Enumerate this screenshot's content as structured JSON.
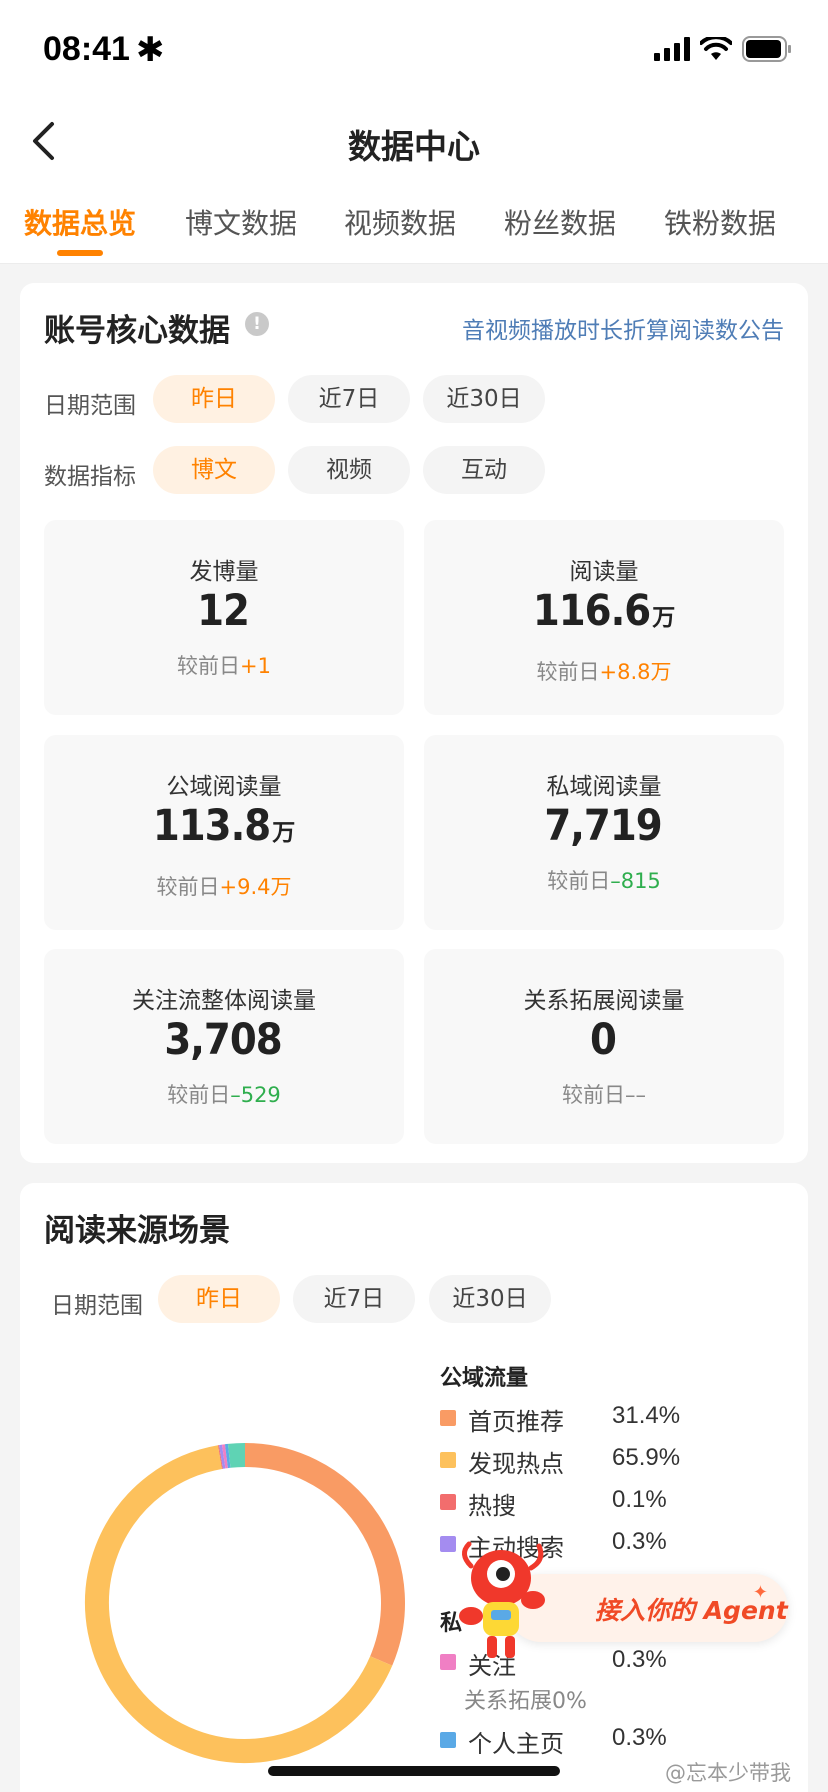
{
  "status": {
    "time": "08:41",
    "star": "✱"
  },
  "nav": {
    "title": "数据中心"
  },
  "tabs": [
    {
      "label": "数据总览",
      "active": true
    },
    {
      "label": "博文数据"
    },
    {
      "label": "视频数据"
    },
    {
      "label": "粉丝数据"
    },
    {
      "label": "铁粉数据"
    }
  ],
  "core": {
    "title": "账号核心数据",
    "info_glyph": "!",
    "notice": "音视频播放时长折算阅读数公告",
    "date_label": "日期范围",
    "date_options": [
      "昨日",
      "近7日",
      "近30日"
    ],
    "metric_label": "数据指标",
    "metric_options": [
      "博文",
      "视频",
      "互动"
    ],
    "compare_label": "较前日",
    "stats": [
      {
        "label": "发博量",
        "value": "12",
        "unit": "",
        "delta": "+1"
      },
      {
        "label": "阅读量",
        "value": "116.6",
        "unit": "万",
        "delta": "+8.8万"
      },
      {
        "label": "公域阅读量",
        "value": "113.8",
        "unit": "万",
        "delta": "+9.4万"
      },
      {
        "label": "私域阅读量",
        "value": "7,719",
        "unit": "",
        "delta": "–815"
      },
      {
        "label": "关注流整体阅读量",
        "value": "3,708",
        "unit": "",
        "delta": "–529"
      },
      {
        "label": "关系拓展阅读量",
        "value": "0",
        "unit": "",
        "delta": "––"
      }
    ]
  },
  "source": {
    "title": "阅读来源场景",
    "date_label": "日期范围",
    "date_options": [
      "昨日",
      "近7日",
      "近30日"
    ],
    "public_title": "公域流量",
    "private_title_fragment": "私",
    "legend": [
      {
        "name": "首页推荐",
        "pct": "31.4%",
        "color": "#f99b64"
      },
      {
        "name": "发现热点",
        "pct": "65.9%",
        "color": "#fdc15c"
      },
      {
        "name": "热搜",
        "pct": "0.1%",
        "color": "#f26d6d"
      },
      {
        "name": "主动搜索",
        "pct": "0.3%",
        "color": "#a48cf0"
      },
      {
        "name": "关注",
        "pct": "0.3%",
        "color": "#f07fc4"
      },
      {
        "name": "个人主页",
        "pct": "0.3%",
        "color": "#5aa9e6"
      }
    ],
    "relation_note": "关系拓展0%"
  },
  "donut_segments": [
    {
      "name": "首页推荐",
      "value": 31.4,
      "color": "#f99b64"
    },
    {
      "name": "发现热点",
      "value": 65.9,
      "color": "#fdc15c"
    },
    {
      "name": "热搜",
      "value": 0.1,
      "color": "#f26d6d"
    },
    {
      "name": "主动搜索",
      "value": 0.3,
      "color": "#a48cf0"
    },
    {
      "name": "关注",
      "value": 0.3,
      "color": "#f07fc4"
    },
    {
      "name": "个人主页",
      "value": 0.3,
      "color": "#5aa9e6"
    },
    {
      "name": "其他",
      "value": 1.7,
      "color": "#5fd3b4"
    }
  ],
  "agent": {
    "label": "接入你的 Agent",
    "spark": "✦"
  },
  "watermark": "@忘本少带我"
}
